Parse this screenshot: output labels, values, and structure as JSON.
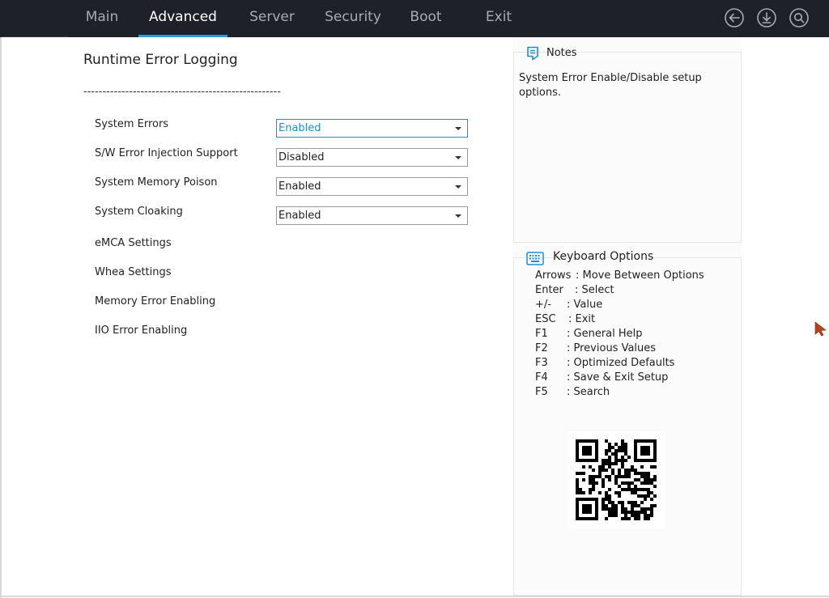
{
  "topbar": {
    "tabs": [
      {
        "label": "Main"
      },
      {
        "label": "Advanced"
      },
      {
        "label": "Server"
      },
      {
        "label": "Security"
      },
      {
        "label": "Boot"
      },
      {
        "label": "Exit"
      }
    ],
    "active_tab": "Advanced",
    "icons": [
      "back-arrow-icon",
      "download-icon",
      "search-icon"
    ]
  },
  "main": {
    "title": "Runtime Error Logging",
    "separator": "----------------------------------------------------",
    "settings": [
      {
        "label": "System Errors",
        "value": "Enabled",
        "focused": true
      },
      {
        "label": "S/W Error Injection Support",
        "value": "Disabled"
      },
      {
        "label": "System Memory Poison",
        "value": "Enabled"
      },
      {
        "label": "System Cloaking",
        "value": "Enabled"
      }
    ],
    "submenus": [
      {
        "label": "eMCA Settings"
      },
      {
        "label": "Whea Settings"
      },
      {
        "label": "Memory Error Enabling"
      },
      {
        "label": "IIO Error Enabling"
      }
    ]
  },
  "notes": {
    "title": "Notes",
    "text": "System Error Enable/Disable setup options."
  },
  "keyboard": {
    "title": "Keyboard Options",
    "rows": [
      {
        "key": "Arrows",
        "desc": ": Move Between Options"
      },
      {
        "key": "Enter",
        "desc": ": Select"
      },
      {
        "key": "+/-",
        "desc": ": Value"
      },
      {
        "key": "ESC",
        "desc": ": Exit"
      },
      {
        "key": "F1",
        "desc": ": General Help"
      },
      {
        "key": "F2",
        "desc": ": Previous Values"
      },
      {
        "key": "F3",
        "desc": ": Optimized Defaults"
      },
      {
        "key": "F4",
        "desc": ": Save & Exit Setup"
      },
      {
        "key": "F5",
        "desc": ": Search"
      }
    ]
  },
  "colors": {
    "topbar_bg": "#1f2129",
    "accent": "#2d9ae8",
    "focus_text": "#1c8fd6",
    "cursor": "#b5441b"
  }
}
